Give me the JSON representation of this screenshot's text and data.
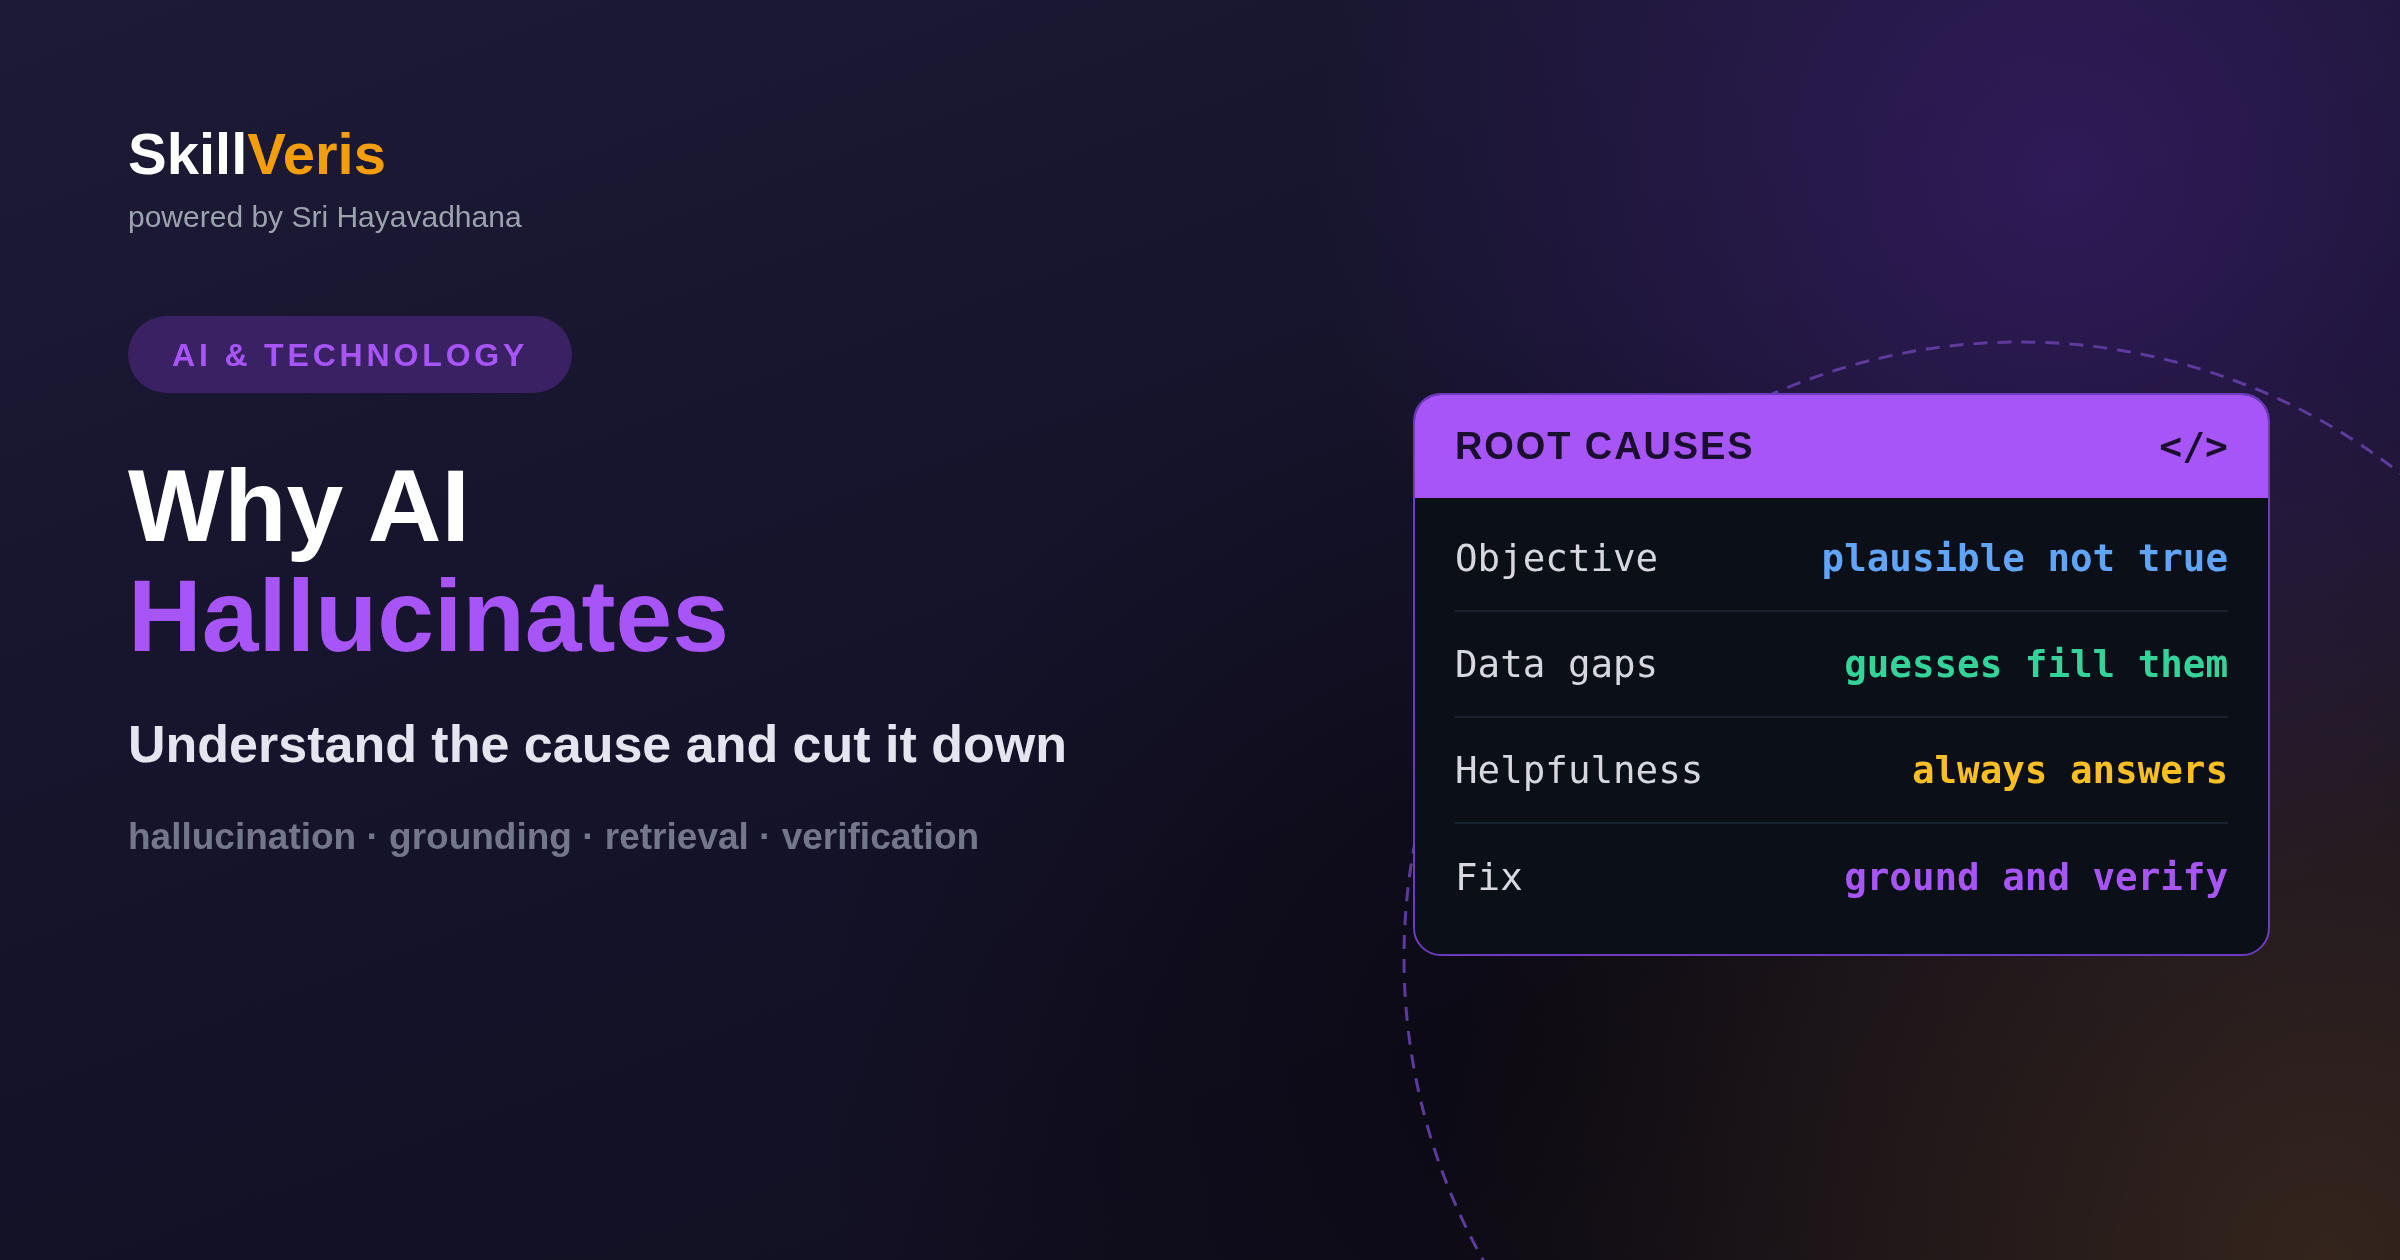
{
  "brand": {
    "name": "Skill",
    "name_accent": "Veris",
    "tagline": "powered by Sri Hayavadhana"
  },
  "category_badge": "AI & TECHNOLOGY",
  "headline": {
    "line_1": "Why AI",
    "line_2": "Hallucinates"
  },
  "subtitle": "Understand the cause and cut it down",
  "keywords": "hallucination · grounding · retrieval · verification",
  "card": {
    "title": "ROOT CAUSES",
    "code_symbol": "</>",
    "rows": [
      {
        "label": "Objective",
        "value": "plausible not true",
        "color": "#60a5fa"
      },
      {
        "label": "Data gaps",
        "value": "guesses fill them",
        "color": "#34d399"
      },
      {
        "label": "Helpfulness",
        "value": "always answers",
        "color": "#fbbf24"
      },
      {
        "label": "Fix",
        "value": "ground and verify",
        "color": "#a855f7"
      }
    ]
  }
}
